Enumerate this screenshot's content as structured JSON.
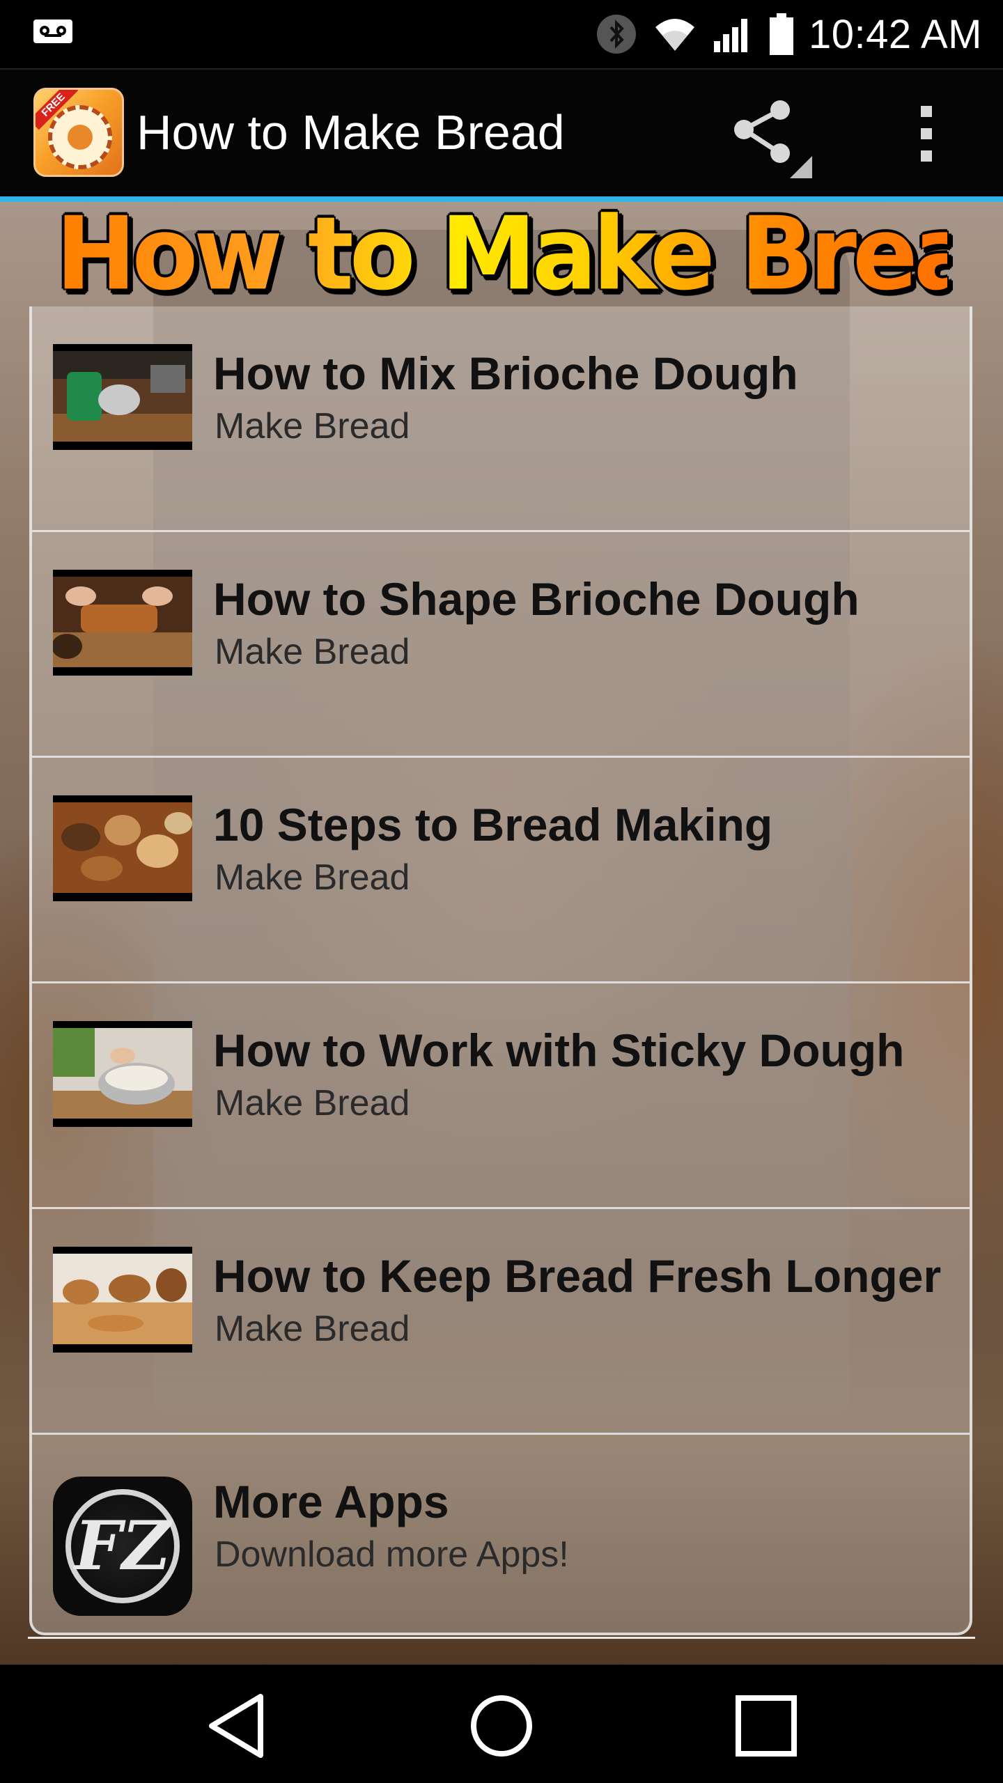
{
  "status_bar": {
    "time": "10:42 AM",
    "icons": [
      "voicemail-icon",
      "bluetooth-icon",
      "wifi-icon",
      "signal-icon",
      "battery-icon"
    ]
  },
  "action_bar": {
    "title": "How to Make Bread",
    "share_icon": "share-icon",
    "overflow_icon": "overflow-menu-icon",
    "accent_color": "#33b5e5"
  },
  "banner": {
    "text": "How to Make Bread"
  },
  "list": {
    "items": [
      {
        "title": "How to Mix Brioche Dough",
        "subtitle": "Make Bread"
      },
      {
        "title": "How to Shape Brioche Dough",
        "subtitle": "Make Bread"
      },
      {
        "title": "10 Steps to Bread Making",
        "subtitle": "Make Bread"
      },
      {
        "title": "How to Work with Sticky Dough",
        "subtitle": "Make Bread"
      },
      {
        "title": "How to Keep Bread Fresh Longer",
        "subtitle": "Make Bread"
      },
      {
        "title": "More Apps",
        "subtitle": "Download more Apps!"
      }
    ]
  },
  "more_apps_logo": {
    "text": "FZ"
  },
  "app_icon": {
    "badge": "FREE"
  },
  "nav_bar": {
    "icons": [
      "back-icon",
      "home-icon",
      "recents-icon"
    ]
  }
}
